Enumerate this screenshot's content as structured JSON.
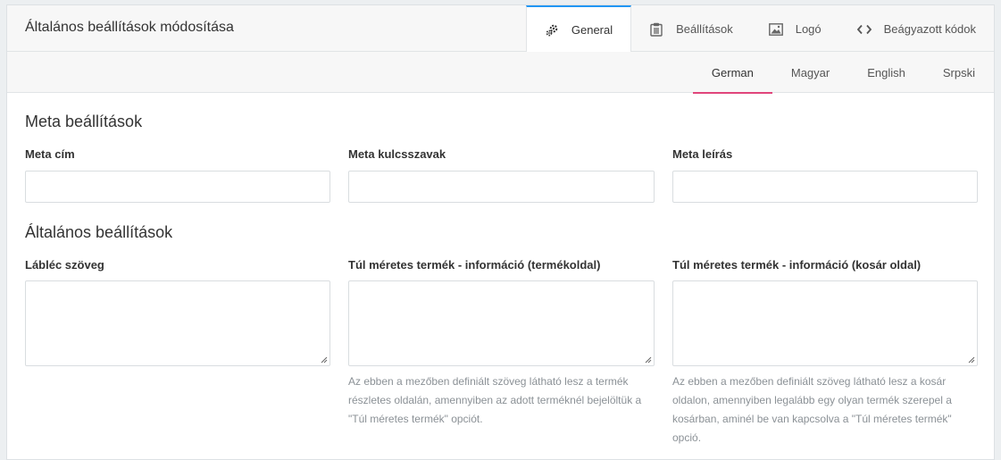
{
  "header": {
    "title": "Általános beállítások módosítása",
    "tabs": [
      {
        "label": "General",
        "icon": "gears-icon",
        "active": true
      },
      {
        "label": "Beállítások",
        "icon": "clipboard-icon",
        "active": false
      },
      {
        "label": "Logó",
        "icon": "image-icon",
        "active": false
      },
      {
        "label": "Beágyazott kódok",
        "icon": "code-icon",
        "active": false
      }
    ]
  },
  "languages": [
    {
      "label": "German",
      "active": true
    },
    {
      "label": "Magyar",
      "active": false
    },
    {
      "label": "English",
      "active": false
    },
    {
      "label": "Srpski",
      "active": false
    }
  ],
  "meta": {
    "title": "Meta beállítások",
    "fields": [
      {
        "label": "Meta cím",
        "value": ""
      },
      {
        "label": "Meta kulcsszavak",
        "value": ""
      },
      {
        "label": "Meta leírás",
        "value": ""
      }
    ]
  },
  "general": {
    "title": "Általános beállítások",
    "fields": [
      {
        "label": "Lábléc szöveg",
        "value": "",
        "help": ""
      },
      {
        "label": "Túl méretes termék - információ (termékoldal)",
        "value": "",
        "help": "Az ebben a mezőben definiált szöveg látható lesz a termék részletes oldalán, amennyiben az adott terméknél bejelöltük a \"Túl méretes termék\" opciót."
      },
      {
        "label": "Túl méretes termék - információ (kosár oldal)",
        "value": "",
        "help": "Az ebben a mezőben definiált szöveg látható lesz a kosár oldalon, amennyiben legalább egy olyan termék szerepel a kosárban, aminél be van kapcsolva a \"Túl méretes termék\" opció."
      }
    ]
  },
  "colors": {
    "active_tab_border": "#2196f3",
    "active_lang_underline": "#e0457b"
  }
}
